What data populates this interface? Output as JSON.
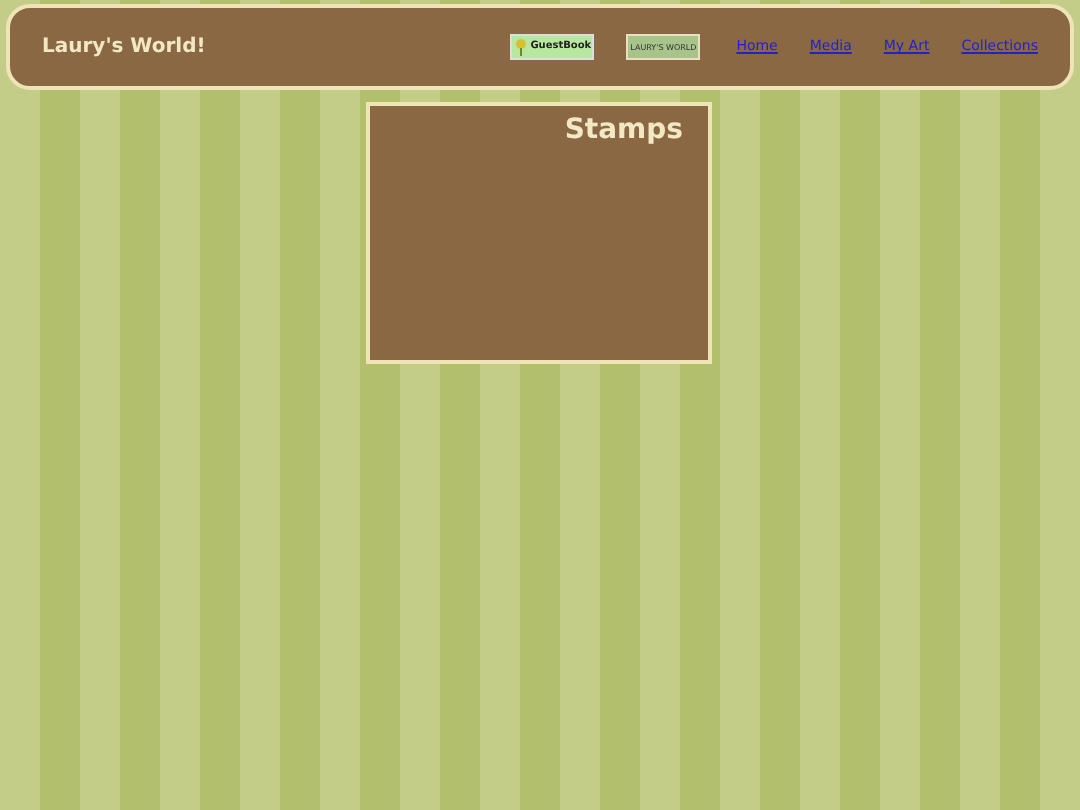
{
  "header": {
    "title": "Laury's World!",
    "badges": [
      {
        "text": "GuestBook"
      },
      {
        "text": "LAURY'S WORLD"
      }
    ],
    "links": [
      "Home",
      "Media",
      "My Art",
      "Collections"
    ]
  },
  "panel": {
    "title": "Stamps"
  }
}
